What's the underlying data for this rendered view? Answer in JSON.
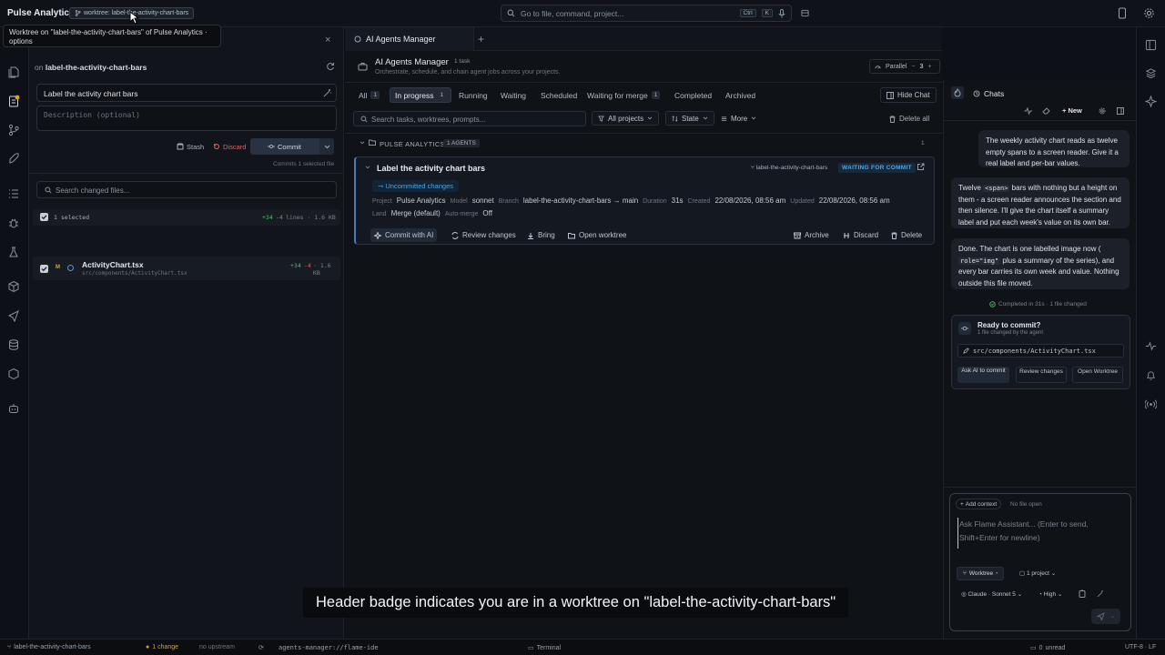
{
  "topbar": {
    "app_name": "Pulse Analytics",
    "worktree_badge": "worktree: label-the-activity-chart-bars",
    "search_placeholder": "Go to file, command, project...",
    "kbd_ctrl": "Ctrl",
    "kbd_k": "K"
  },
  "tooltip": "Worktree on \"label-the-activity-chart-bars\" of Pulse Analytics · options",
  "left_panel": {
    "branch_prefix": "on",
    "branch_name": "label-the-activity-chart-bars",
    "title_value": "Label the activity chart bars",
    "description_placeholder": "Description (optional)",
    "stash_label": "Stash",
    "discard_label": "Discard",
    "commit_label": "Commit",
    "commit_note": "Commits 1 selected file",
    "search_placeholder": "Search changed files...",
    "selected_label": "1 selected",
    "selected_added": "+34",
    "selected_removed": "-4",
    "selected_lines": "lines · 1.6 KB",
    "file": {
      "badge": "M",
      "name": "ActivityChart.tsx",
      "path": "src/components/ActivityChart.tsx",
      "added": "+34",
      "removed": "-4",
      "size": "· 1.6 KB"
    }
  },
  "center": {
    "tab_label": "AI Agents Manager",
    "header_title": "AI Agents Manager",
    "header_count": "1 task",
    "header_subtitle": "Orchestrate, schedule, and chain agent jobs across your projects.",
    "parallel_label": "Parallel",
    "parallel_value": "3",
    "tabs": [
      {
        "label": "All",
        "count": "1"
      },
      {
        "label": "In progress",
        "count": "1"
      },
      {
        "label": "Running",
        "count": ""
      },
      {
        "label": "Waiting",
        "count": ""
      },
      {
        "label": "Scheduled",
        "count": ""
      },
      {
        "label": "Waiting for merge",
        "count": "1"
      },
      {
        "label": "Completed",
        "count": ""
      },
      {
        "label": "Archived",
        "count": ""
      }
    ],
    "hide_chat_label": "Hide Chat",
    "search_placeholder": "Search tasks, worktrees, prompts...",
    "filter_projects": "All projects",
    "filter_state": "State",
    "filter_more": "More",
    "delete_all": "Delete all",
    "group_name": "PULSE ANALYTICS",
    "group_agents": "1 AGENTS",
    "group_count": "1",
    "task": {
      "title": "Label the activity chart bars",
      "branch_chip": "label-the-activity-chart-bars",
      "status": "WAITING FOR COMMIT",
      "uncommitted": "Uncommitted changes",
      "project_k": "Project",
      "project_v": "Pulse Analytics",
      "model_k": "Model",
      "model_v": "sonnet",
      "branch_k": "Branch",
      "branch_v": "label-the-activity-chart-bars → main",
      "duration_k": "Duration",
      "duration_v": "31s",
      "created_k": "Created",
      "created_v": "22/08/2026, 08:56 am",
      "updated_k": "Updated",
      "updated_v": "22/08/2026, 08:56 am",
      "land_k": "Land",
      "land_v": "Merge (default)",
      "automerge_k": "Auto-merge",
      "automerge_v": "Off",
      "actions": {
        "commit_ai": "Commit with AI",
        "review": "Review changes",
        "bring": "Bring",
        "open_worktree": "Open worktree",
        "archive": "Archive",
        "discard": "Discard",
        "delete": "Delete"
      }
    }
  },
  "chat": {
    "title": "Chats",
    "new_label": "New",
    "user_msg1": "The weekly activity chart reads as twelve empty spans to a screen reader. Give it a real label and per-bar values.",
    "ai_msg1_a": "Twelve",
    "ai_msg1_code": "<span>",
    "ai_msg1_b": "bars with nothing but a height on them - a screen reader announces the section and then silence. I'll give the chart itself a summary label and put each week's value on its own bar.",
    "ai_msg2_a": "Done. The chart is one labelled image now (",
    "ai_msg2_code": "role=\"img\"",
    "ai_msg2_b": "plus a summary of the series), and every bar carries its own week and value. Nothing outside this file moved.",
    "completed": "Completed in 31s · 1 file changed",
    "ready_title": "Ready to commit?",
    "ready_sub": "1 file changed by the agent",
    "ready_file": "src/components/ActivityChart.tsx",
    "btn_ask": "Ask AI to commit",
    "btn_review": "Review changes",
    "btn_open": "Open Worktree",
    "add_context": "Add context",
    "no_file": "No file open",
    "input_placeholder": "Ask Flame Assistant... (Enter to send, Shift+Enter for newline)",
    "worktree_chip": "Worktree",
    "project_chip": "1 project",
    "model_chip": "Claude · Sonnet 5",
    "effort_chip": "High"
  },
  "caption": "Header badge indicates you are in a worktree on \"label-the-activity-chart-bars\"",
  "statusbar": {
    "branch": "label-the-activity-chart-bars",
    "changes": "1 change",
    "upstream": "no upstream",
    "path": "agents-manager://flame-ide",
    "terminal": "Terminal",
    "unread_count": "0",
    "unread": "unread",
    "encoding": "UTF-8 · LF"
  }
}
